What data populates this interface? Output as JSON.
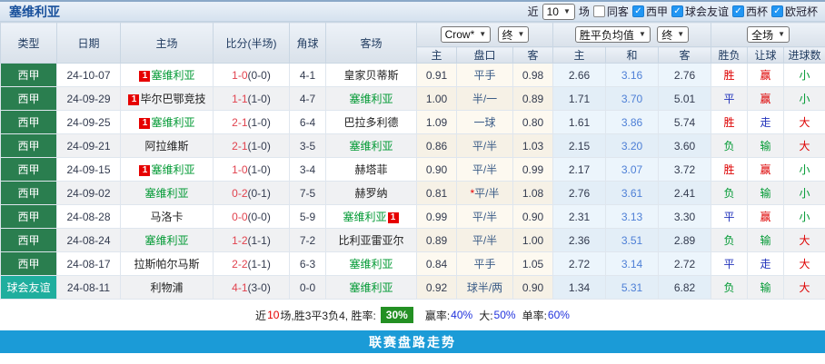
{
  "header": {
    "title": "塞维利亚",
    "recent_label": "近",
    "recent_suffix": "场",
    "checkboxes": [
      {
        "label": "同客",
        "checked": false
      },
      {
        "label": "西甲",
        "checked": true
      },
      {
        "label": "球会友谊",
        "checked": true
      },
      {
        "label": "西杯",
        "checked": true
      },
      {
        "label": "欧冠杯",
        "checked": true
      }
    ]
  },
  "selects": {
    "recent": "10",
    "company": "Crow*",
    "company_status": "终",
    "metric": "胜平负均值",
    "metric_status": "终",
    "scope": "全场"
  },
  "table": {
    "main_headers": [
      "类型",
      "日期",
      "主场",
      "比分(半场)",
      "角球",
      "客场"
    ],
    "sub_headers": [
      "主",
      "盘口",
      "客",
      "主",
      "和",
      "客",
      "胜负",
      "让球",
      "进球数"
    ],
    "rows": [
      {
        "type": "西甲",
        "friendly": false,
        "date": "24-10-07",
        "home": {
          "name": "塞维利亚",
          "green": true,
          "badge": "1",
          "badge_pos": "before"
        },
        "ft": "1-0",
        "ht": "(0-0)",
        "corners": "4-1",
        "away": {
          "name": "皇家贝蒂斯",
          "green": false
        },
        "o_home": "0.91",
        "handicap": "平手",
        "h_star": false,
        "o_away": "0.98",
        "avg_home": "2.66",
        "avg_draw": "3.16",
        "avg_away": "2.76",
        "res": {
          "t": "胜",
          "c": "red"
        },
        "let": {
          "t": "赢",
          "c": "red"
        },
        "goal": {
          "t": "小",
          "c": "green"
        }
      },
      {
        "type": "西甲",
        "friendly": false,
        "date": "24-09-29",
        "home": {
          "name": "毕尔巴鄂竞技",
          "green": false,
          "badge": "1",
          "badge_pos": "before"
        },
        "ft": "1-1",
        "ht": "(1-0)",
        "corners": "4-7",
        "away": {
          "name": "塞维利亚",
          "green": true
        },
        "o_home": "1.00",
        "handicap": "半/一",
        "h_star": false,
        "o_away": "0.89",
        "avg_home": "1.71",
        "avg_draw": "3.70",
        "avg_away": "5.01",
        "res": {
          "t": "平",
          "c": "blue"
        },
        "let": {
          "t": "赢",
          "c": "red"
        },
        "goal": {
          "t": "小",
          "c": "green"
        }
      },
      {
        "type": "西甲",
        "friendly": false,
        "date": "24-09-25",
        "home": {
          "name": "塞维利亚",
          "green": true,
          "badge": "1",
          "badge_pos": "before"
        },
        "ft": "2-1",
        "ht": "(1-0)",
        "corners": "6-4",
        "away": {
          "name": "巴拉多利德",
          "green": false
        },
        "o_home": "1.09",
        "handicap": "一球",
        "h_star": false,
        "o_away": "0.80",
        "avg_home": "1.61",
        "avg_draw": "3.86",
        "avg_away": "5.74",
        "res": {
          "t": "胜",
          "c": "red"
        },
        "let": {
          "t": "走",
          "c": "blue"
        },
        "goal": {
          "t": "大",
          "c": "red"
        }
      },
      {
        "type": "西甲",
        "friendly": false,
        "date": "24-09-21",
        "home": {
          "name": "阿拉维斯",
          "green": false
        },
        "ft": "2-1",
        "ht": "(1-0)",
        "corners": "3-5",
        "away": {
          "name": "塞维利亚",
          "green": true
        },
        "o_home": "0.86",
        "handicap": "平/半",
        "h_star": false,
        "o_away": "1.03",
        "avg_home": "2.15",
        "avg_draw": "3.20",
        "avg_away": "3.60",
        "res": {
          "t": "负",
          "c": "green"
        },
        "let": {
          "t": "输",
          "c": "green"
        },
        "goal": {
          "t": "大",
          "c": "red"
        }
      },
      {
        "type": "西甲",
        "friendly": false,
        "date": "24-09-15",
        "home": {
          "name": "塞维利亚",
          "green": true,
          "badge": "1",
          "badge_pos": "before"
        },
        "ft": "1-0",
        "ht": "(1-0)",
        "corners": "3-4",
        "away": {
          "name": "赫塔菲",
          "green": false
        },
        "o_home": "0.90",
        "handicap": "平/半",
        "h_star": false,
        "o_away": "0.99",
        "avg_home": "2.17",
        "avg_draw": "3.07",
        "avg_away": "3.72",
        "res": {
          "t": "胜",
          "c": "red"
        },
        "let": {
          "t": "赢",
          "c": "red"
        },
        "goal": {
          "t": "小",
          "c": "green"
        }
      },
      {
        "type": "西甲",
        "friendly": false,
        "date": "24-09-02",
        "home": {
          "name": "塞维利亚",
          "green": true
        },
        "ft": "0-2",
        "ht": "(0-1)",
        "corners": "7-5",
        "away": {
          "name": "赫罗纳",
          "green": false
        },
        "o_home": "0.81",
        "handicap": "平/半",
        "h_star": true,
        "o_away": "1.08",
        "avg_home": "2.76",
        "avg_draw": "3.61",
        "avg_away": "2.41",
        "res": {
          "t": "负",
          "c": "green"
        },
        "let": {
          "t": "输",
          "c": "green"
        },
        "goal": {
          "t": "小",
          "c": "green"
        }
      },
      {
        "type": "西甲",
        "friendly": false,
        "date": "24-08-28",
        "home": {
          "name": "马洛卡",
          "green": false
        },
        "ft": "0-0",
        "ht": "(0-0)",
        "corners": "5-9",
        "away": {
          "name": "塞维利亚",
          "green": true,
          "badge": "1",
          "badge_pos": "after"
        },
        "o_home": "0.99",
        "handicap": "平/半",
        "h_star": false,
        "o_away": "0.90",
        "avg_home": "2.31",
        "avg_draw": "3.13",
        "avg_away": "3.30",
        "res": {
          "t": "平",
          "c": "blue"
        },
        "let": {
          "t": "赢",
          "c": "red"
        },
        "goal": {
          "t": "小",
          "c": "green"
        }
      },
      {
        "type": "西甲",
        "friendly": false,
        "date": "24-08-24",
        "home": {
          "name": "塞维利亚",
          "green": true
        },
        "ft": "1-2",
        "ht": "(1-1)",
        "corners": "7-2",
        "away": {
          "name": "比利亚雷亚尔",
          "green": false
        },
        "o_home": "0.89",
        "handicap": "平/半",
        "h_star": false,
        "o_away": "1.00",
        "avg_home": "2.36",
        "avg_draw": "3.51",
        "avg_away": "2.89",
        "res": {
          "t": "负",
          "c": "green"
        },
        "let": {
          "t": "输",
          "c": "green"
        },
        "goal": {
          "t": "大",
          "c": "red"
        }
      },
      {
        "type": "西甲",
        "friendly": false,
        "date": "24-08-17",
        "home": {
          "name": "拉斯帕尔马斯",
          "green": false
        },
        "ft": "2-2",
        "ht": "(1-1)",
        "corners": "6-3",
        "away": {
          "name": "塞维利亚",
          "green": true
        },
        "o_home": "0.84",
        "handicap": "平手",
        "h_star": false,
        "o_away": "1.05",
        "avg_home": "2.72",
        "avg_draw": "3.14",
        "avg_away": "2.72",
        "res": {
          "t": "平",
          "c": "blue"
        },
        "let": {
          "t": "走",
          "c": "blue"
        },
        "goal": {
          "t": "大",
          "c": "red"
        }
      },
      {
        "type": "球会友谊",
        "friendly": true,
        "date": "24-08-11",
        "home": {
          "name": "利物浦",
          "green": false
        },
        "ft": "4-1",
        "ht": "(3-0)",
        "corners": "0-0",
        "away": {
          "name": "塞维利亚",
          "green": true
        },
        "o_home": "0.92",
        "handicap": "球半/两",
        "h_star": false,
        "o_away": "0.90",
        "avg_home": "1.34",
        "avg_draw": "5.31",
        "avg_away": "6.82",
        "res": {
          "t": "负",
          "c": "green"
        },
        "let": {
          "t": "输",
          "c": "green"
        },
        "goal": {
          "t": "大",
          "c": "red"
        }
      }
    ]
  },
  "summary": {
    "prefix": "近",
    "count": "10",
    "mid": "场,胜3平3负4, 胜率:",
    "win_rate": "30%",
    "seg2_label": "赢率:",
    "seg2_value": "40%",
    "seg3_label": "大:",
    "seg3_value": "50%",
    "seg4_label": "单率:",
    "seg4_value": "60%"
  },
  "bottom_bar": {
    "label": "联赛盘路走势"
  },
  "colors": {
    "team_green": "#009933",
    "result_red": "#dd0000",
    "result_blue": "#2233bb",
    "league_cell_bg": "#2a7e4f",
    "friendly_cell_bg": "#1fae9e",
    "badge_bg": "#e60000",
    "win_rate_badge_bg": "#239023",
    "bottom_bar_bg": "#1b9bd7",
    "checkbox_on_bg": "#2196f3"
  }
}
